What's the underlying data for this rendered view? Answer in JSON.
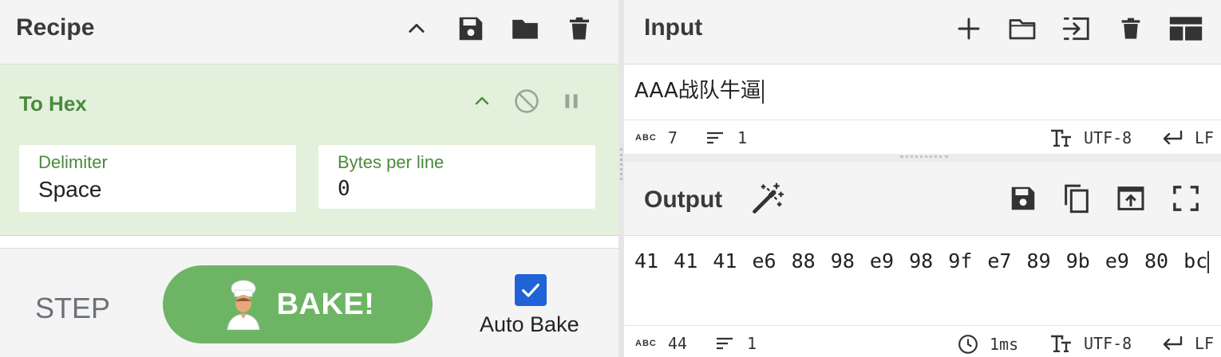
{
  "recipe": {
    "title": "Recipe",
    "icons": [
      "chevron-up-icon",
      "save-icon",
      "folder-icon",
      "trash-icon"
    ]
  },
  "operation": {
    "name": "To Hex",
    "args": [
      {
        "label": "Delimiter",
        "value": "Space"
      },
      {
        "label": "Bytes per line",
        "value": "0"
      }
    ]
  },
  "controls": {
    "step_label": "STEP",
    "bake_label": "BAKE!",
    "auto_bake_label": "Auto Bake",
    "auto_bake_checked": true
  },
  "input": {
    "title": "Input",
    "value": "AAA战队牛逼",
    "status": {
      "chars": "7",
      "lines": "1",
      "encoding": "UTF-8",
      "eol": "LF"
    }
  },
  "output": {
    "title": "Output",
    "value": "41 41 41 e6 88 98 e9 98 9f e7 89 9b e9 80 bc",
    "status": {
      "chars": "44",
      "lines": "1",
      "time": "1ms",
      "encoding": "UTF-8",
      "eol": "LF"
    }
  },
  "colors": {
    "accent_green": "#4b8a3e",
    "op_background": "#e3f0dc",
    "bake_button": "#6db565",
    "checkbox": "#1f63d6"
  }
}
